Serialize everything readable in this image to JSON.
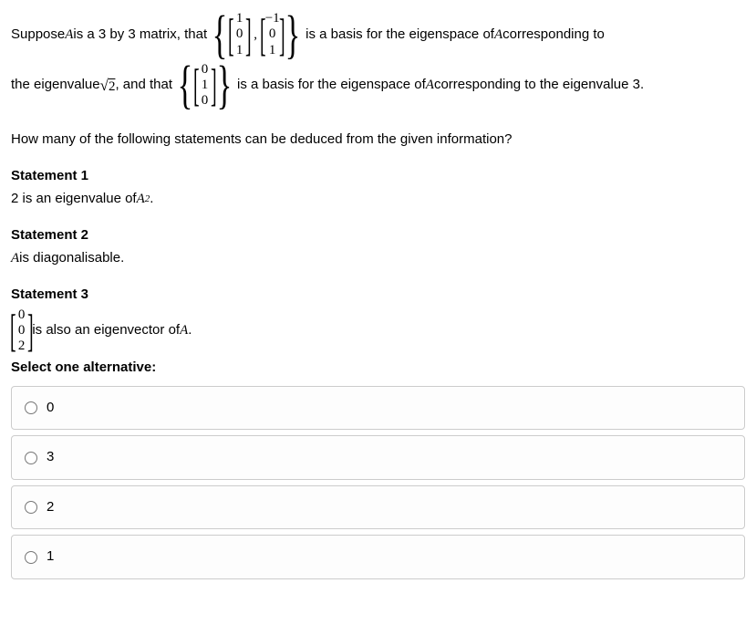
{
  "intro": {
    "part1": "Suppose ",
    "A": "A",
    "part2": " is a 3 by 3 matrix, that ",
    "set1": {
      "v1": [
        "1",
        "0",
        "1"
      ],
      "v2": [
        "−1",
        "0",
        "1"
      ]
    },
    "part3": " is a basis for the eigenspace of ",
    "A2": "A",
    "part4": " corresponding to",
    "part5": "the eigenvalue ",
    "sqrt2_radicand": "2",
    "part6": ", and that ",
    "set2": {
      "v1": [
        "0",
        "1",
        "0"
      ]
    },
    "part7": " is a basis for the eigenspace of ",
    "A3": "A",
    "part8": " corresponding to the eigenvalue 3."
  },
  "question": "How many of the following statements can be deduced from the given information?",
  "statements": {
    "s1": {
      "title": "Statement 1",
      "pre": "2 is an eigenvalue of ",
      "var": "A",
      "exp": "2",
      "post": "."
    },
    "s2": {
      "title": "Statement 2",
      "var": "A",
      "post": " is diagonalisable."
    },
    "s3": {
      "title": "Statement 3",
      "vec": [
        "0",
        "0",
        "2"
      ],
      "post": " is also an eigenvector of ",
      "var": "A",
      "post2": "."
    }
  },
  "select_label": "Select one alternative:",
  "options": [
    "0",
    "3",
    "2",
    "1"
  ]
}
